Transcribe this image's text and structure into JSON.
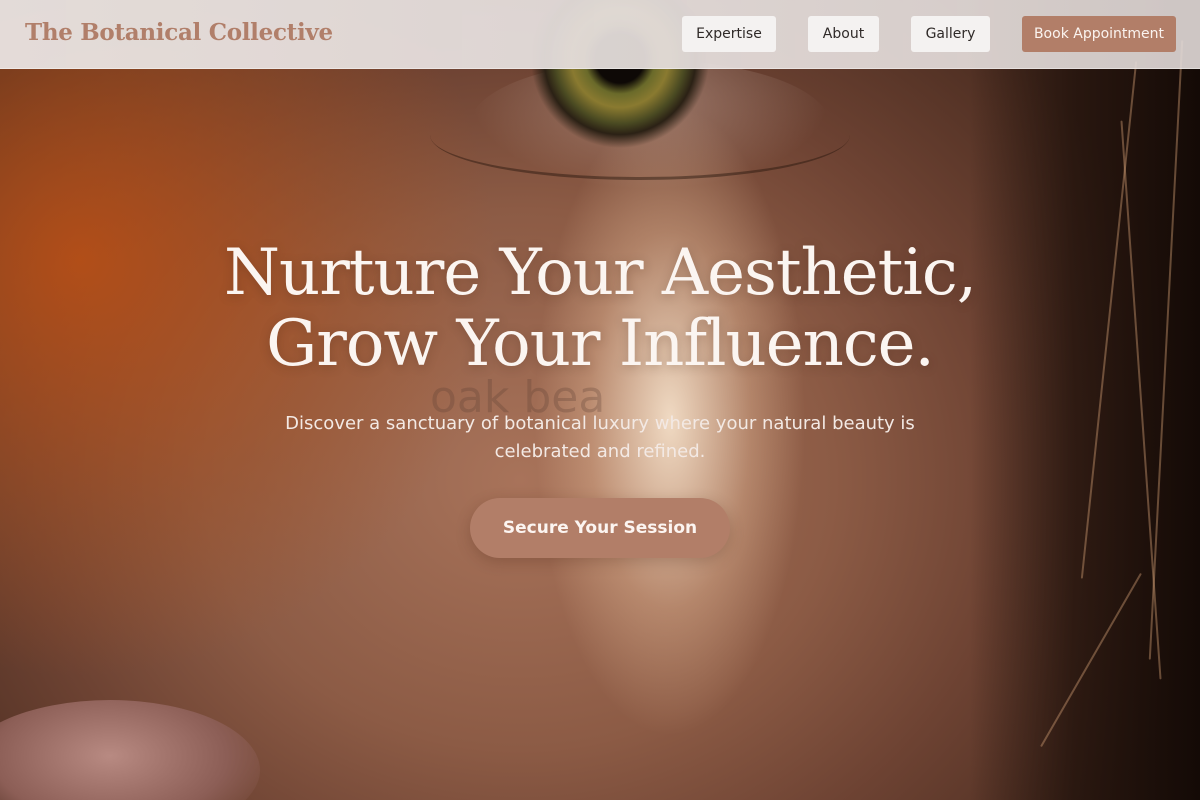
{
  "header": {
    "brand": "The Botanical Collective",
    "nav": [
      {
        "label": "Expertise"
      },
      {
        "label": "About"
      },
      {
        "label": "Gallery"
      }
    ],
    "cta_label": "Book Appointment"
  },
  "hero": {
    "headline_line1": "Nurture Your Aesthetic,",
    "headline_line2": "Grow Your Influence.",
    "ghost_text": "oak bea",
    "subhead": "Discover a sanctuary of botanical luxury where your natural beauty is celebrated and refined.",
    "cta_label": "Secure Your Session"
  },
  "colors": {
    "accent": "#b27e68",
    "brand_text": "#b17f6a",
    "header_bg": "#e6dfdd",
    "nav_button_bg": "#f4f2f1"
  }
}
